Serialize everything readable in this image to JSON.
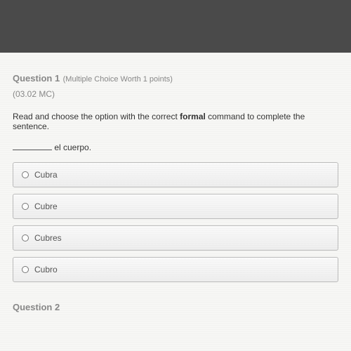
{
  "question": {
    "title": "Question 1",
    "meta": "(Multiple Choice Worth 1 points)",
    "code": "(03.02 MC)",
    "instruction_pre": "Read and choose the option with the correct ",
    "instruction_bold": "formal",
    "instruction_post": " command to complete the sentence.",
    "sentence_after_blank": " el cuerpo."
  },
  "options": [
    {
      "label": "Cubra"
    },
    {
      "label": "Cubre"
    },
    {
      "label": "Cubres"
    },
    {
      "label": "Cubro"
    }
  ],
  "next_question_hint": "Question 2"
}
